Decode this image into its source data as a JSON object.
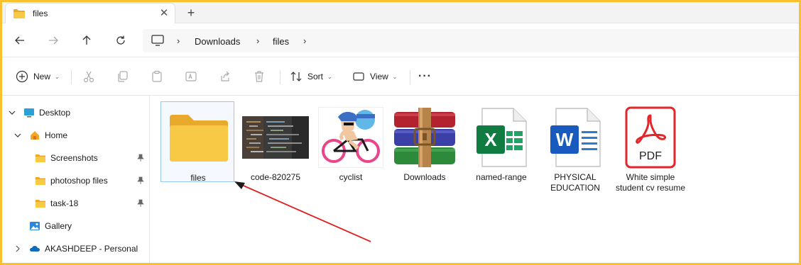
{
  "tab": {
    "title": "files",
    "close_glyph": "✕",
    "new_glyph": "+"
  },
  "nav": {
    "back": "back-arrow-icon",
    "forward": "forward-arrow-icon",
    "up": "up-arrow-icon",
    "refresh": "refresh-icon"
  },
  "breadcrumb": {
    "sep": "›",
    "items": [
      "Downloads",
      "files"
    ]
  },
  "toolbar": {
    "new_label": "New",
    "sort_label": "Sort",
    "view_label": "View",
    "more_glyph": "···",
    "caret": "⌄"
  },
  "sidebar": {
    "items": [
      {
        "label": "Desktop",
        "icon": "desktop-icon"
      },
      {
        "label": "Home",
        "icon": "home-icon"
      },
      {
        "label": "Screenshots",
        "icon": "folder-icon"
      },
      {
        "label": "photoshop files",
        "icon": "folder-icon"
      },
      {
        "label": "task-18",
        "icon": "folder-icon"
      },
      {
        "label": "Gallery",
        "icon": "gallery-icon"
      },
      {
        "label": "AKASHDEEP - Personal",
        "icon": "onedrive-icon"
      }
    ]
  },
  "files": [
    {
      "label": "files",
      "type": "folder"
    },
    {
      "label": "code-820275",
      "type": "image"
    },
    {
      "label": "cyclist",
      "type": "image"
    },
    {
      "label": "Downloads",
      "type": "winrar"
    },
    {
      "label": "named-range",
      "type": "excel"
    },
    {
      "label": "PHYSICAL EDUCATION",
      "type": "word"
    },
    {
      "label": "White simple student cv resume",
      "type": "pdf"
    }
  ],
  "pdf_badge": "PDF",
  "excel_letter": "X",
  "word_letter": "W",
  "colors": {
    "accent_border": "#fbc02d",
    "folder": "#f8c944",
    "arrow": "#e02020",
    "selection": "#99c9f0"
  }
}
